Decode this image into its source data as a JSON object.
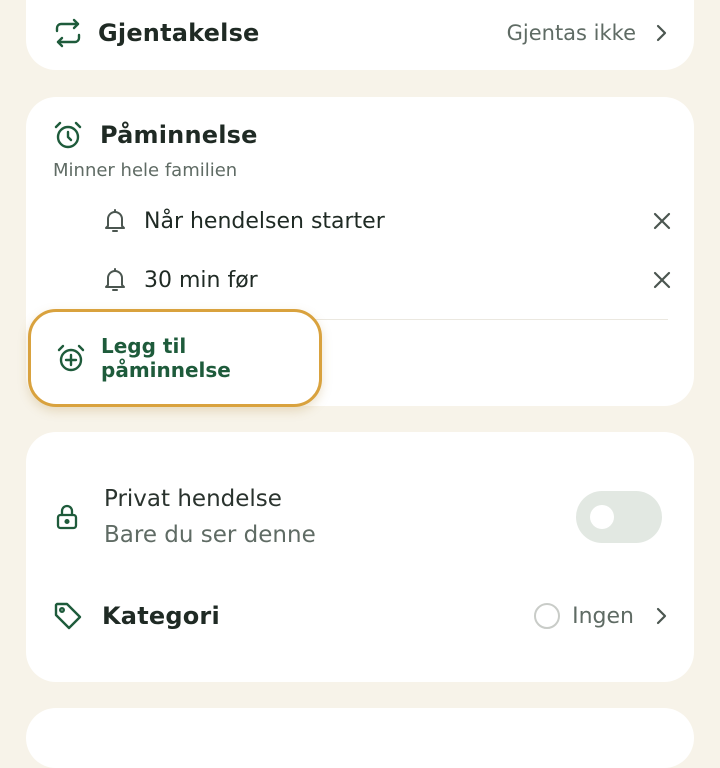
{
  "colors": {
    "accent_green": "#1e5b3b",
    "highlight_border": "#d9a23e",
    "background": "#f7f3e9",
    "card": "#ffffff"
  },
  "repeat": {
    "icon": "repeat-icon",
    "label": "Gjentakelse",
    "value": "Gjentas ikke",
    "chevron_icon": "chevron-right-icon"
  },
  "reminder": {
    "icon": "alarm-clock-icon",
    "title": "Påminnelse",
    "subtitle": "Minner hele familien",
    "items": [
      {
        "icon": "bell-icon",
        "label": "Når hendelsen starter",
        "remove_icon": "close-icon"
      },
      {
        "icon": "bell-icon",
        "label": "30 min før",
        "remove_icon": "close-icon"
      }
    ],
    "add_icon": "alarm-add-icon",
    "add_label": "Legg til påminnelse"
  },
  "privacy": {
    "icon": "lock-icon",
    "title": "Privat hendelse",
    "subtitle": "Bare du ser denne",
    "toggle_on": false
  },
  "category": {
    "icon": "tag-icon",
    "label": "Kategori",
    "value": "Ingen",
    "chevron_icon": "chevron-right-icon"
  }
}
